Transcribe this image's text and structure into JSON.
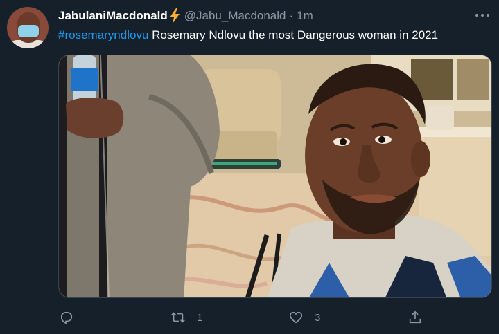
{
  "tweet": {
    "author": {
      "display_name": "JabulaniMacdonald",
      "handle": "@Jabu_Macdonald",
      "badge_icon": "lightning-bolt-icon",
      "avatar_icon": "avatar-masked-man"
    },
    "separator": "·",
    "timestamp": "1m",
    "hashtag": "#rosemaryndlovu",
    "body": " Rosemary Ndlovu the most Dangerous woman in 2021",
    "media": {
      "type": "photo"
    },
    "actions": {
      "reply": {
        "icon": "reply-icon"
      },
      "retweet": {
        "icon": "retweet-icon",
        "count": "1"
      },
      "like": {
        "icon": "heart-icon",
        "count": "3"
      },
      "share": {
        "icon": "share-icon"
      }
    },
    "more_icon": "more-options-icon"
  },
  "colors": {
    "background": "#15202b",
    "text_primary": "#ffffff",
    "text_secondary": "#8b98a5",
    "link": "#1d9bf0",
    "bolt": "#ffac33"
  }
}
